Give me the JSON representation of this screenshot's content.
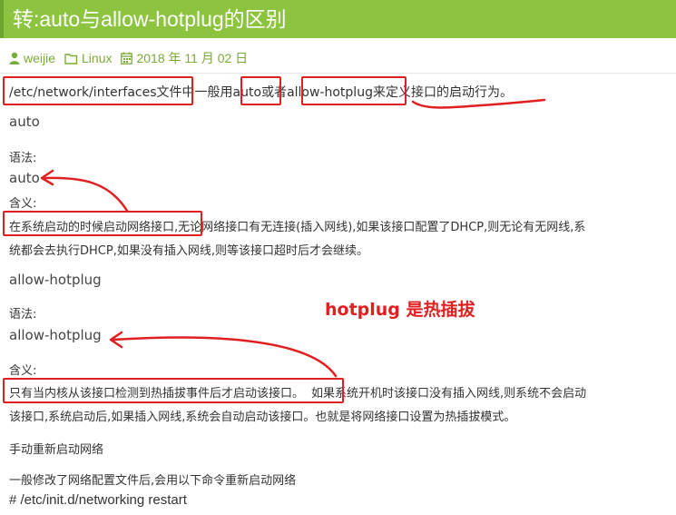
{
  "article": {
    "title": "转:auto与allow-hotplug的区别",
    "author": "weijie",
    "category": "Linux",
    "date": "2018 年 11 月 02 日"
  },
  "intro": {
    "part1": "/etc/network/interfaces文件",
    "part2": "中一般用",
    "part3": "auto",
    "part4": "或者",
    "part5": "allow-hotplug",
    "part6": "来定义接口的启动行为。"
  },
  "auto_section": {
    "heading": "auto",
    "syntax_label": "语法:",
    "syntax_value": "auto",
    "meaning_label": "含义:",
    "meaning_highlight": "在系统启动的时候启动网络接口",
    "meaning_rest1": ",无论网络接口有无连接(插入网线),如果该接口配置了DHCP,则无论有无网线,系",
    "meaning_rest2": "统都会去执行DHCP,如果没有插入网线,则等该接口超时后才会继续。"
  },
  "hotplug_section": {
    "heading": "allow-hotplug",
    "syntax_label": "语法:",
    "syntax_value": "allow-hotplug",
    "meaning_label": "含义:",
    "meaning_highlight": "只有当内核从该接口检测到热插拔事件后才启动该接口。",
    "meaning_rest1": "如果系统开机时该接口没有插入网线,则系统不会启动",
    "meaning_rest2": "该接口,系统启动后,如果插入网线,系统会自动启动该接口。也就是将网络接口设置为热插拔模式。"
  },
  "annotation_note": "hotplug 是热插拔",
  "restart": {
    "heading": "手动重新启动网络",
    "desc": "一般修改了网络配置文件后,会用以下命令重新启动网络",
    "command": "# /etc/init.d/networking restart"
  },
  "colors": {
    "title_bg": "#8cc43f",
    "meta": "#7aaa3a",
    "annotation": "#e02020"
  },
  "icons": [
    "user-icon",
    "folder-icon",
    "calendar-icon"
  ]
}
